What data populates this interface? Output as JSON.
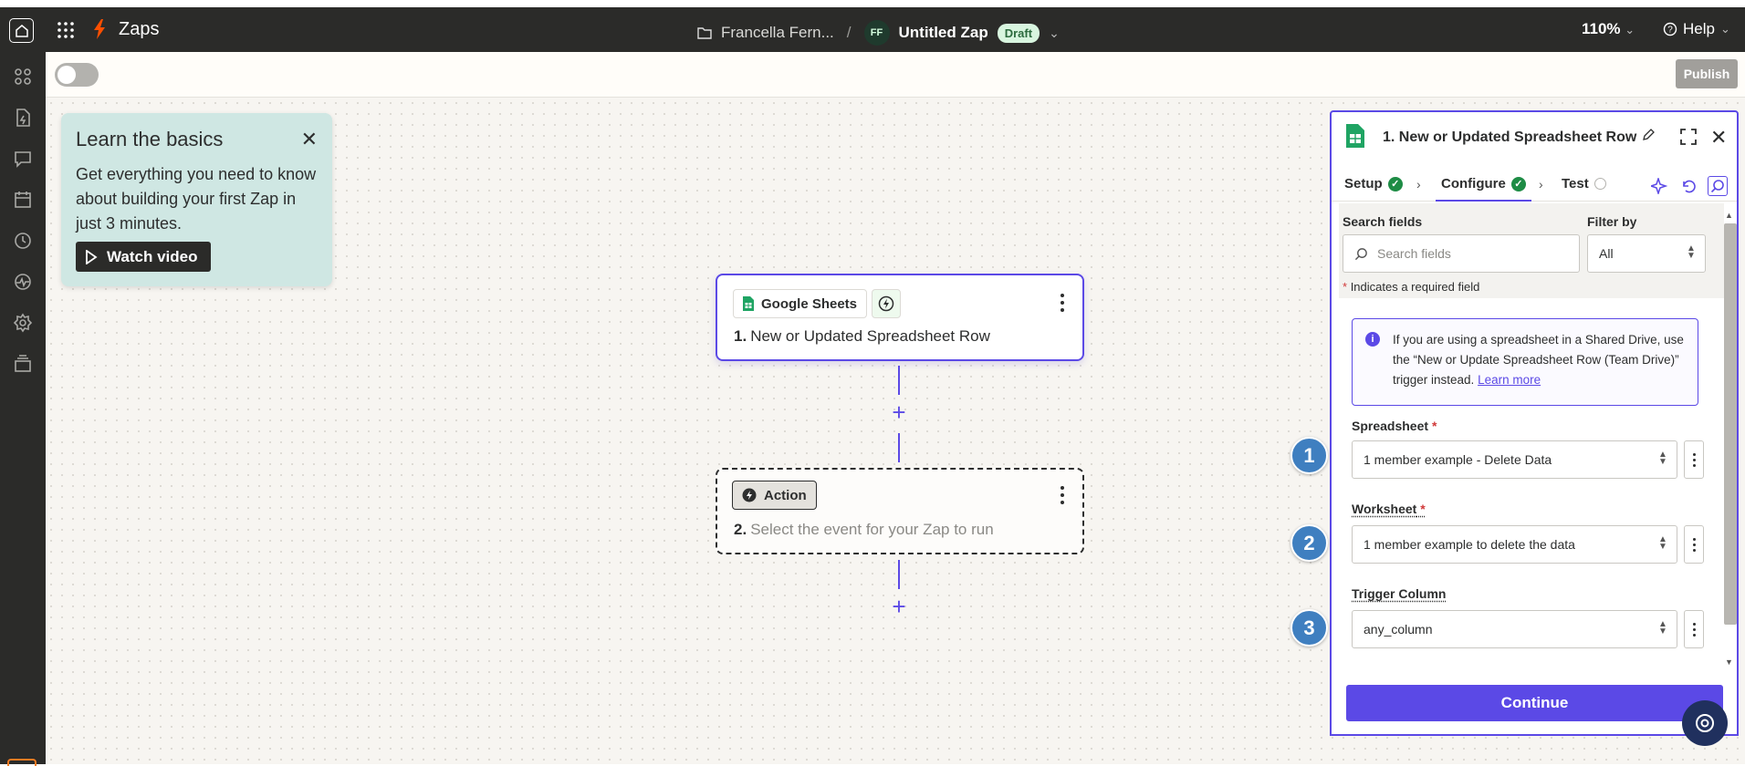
{
  "topbar": {
    "app_title": "Zaps",
    "breadcrumb_folder": "Francella Fern...",
    "breadcrumb_sep": "/",
    "owner_initials": "FF",
    "zap_name": "Untitled Zap",
    "zap_status": "Draft",
    "zoom": "110%",
    "help": "Help"
  },
  "toolbar": {
    "publish": "Publish"
  },
  "learn_card": {
    "title": "Learn the basics",
    "body": "Get everything you need to know about building your first Zap in just 3 minutes.",
    "button": "Watch video"
  },
  "nodes": [
    {
      "app": "Google Sheets",
      "number": "1.",
      "title": "New or Updated Spreadsheet Row"
    },
    {
      "app": "Action",
      "number": "2.",
      "title": "Select the event for your Zap to run"
    }
  ],
  "panel": {
    "title": "1. New or Updated Spreadsheet Row",
    "tabs": [
      "Setup",
      "Configure",
      "Test"
    ],
    "search_label": "Search fields",
    "search_placeholder": "Search fields",
    "filter_label": "Filter by",
    "filter_value": "All",
    "required_note": "Indicates a required field",
    "info_text": "If you are using a spreadsheet in a Shared Drive, use the “New or Update Spreadsheet Row (Team Drive)” trigger instead.",
    "info_link": "Learn more",
    "fields": [
      {
        "label": "Spreadsheet",
        "value": "1 member example - Delete Data",
        "marker": "1"
      },
      {
        "label": "Worksheet",
        "value": "1 member example to delete the data",
        "marker": "2"
      },
      {
        "label": "Trigger Column",
        "value": "any_column",
        "marker": "3"
      }
    ],
    "continue": "Continue"
  },
  "colors": {
    "accent": "#5b49e6",
    "success": "#1e8c45",
    "topbar": "#2b2b29",
    "zap_orange": "#ff4f00",
    "marker": "#3f7fc0"
  }
}
